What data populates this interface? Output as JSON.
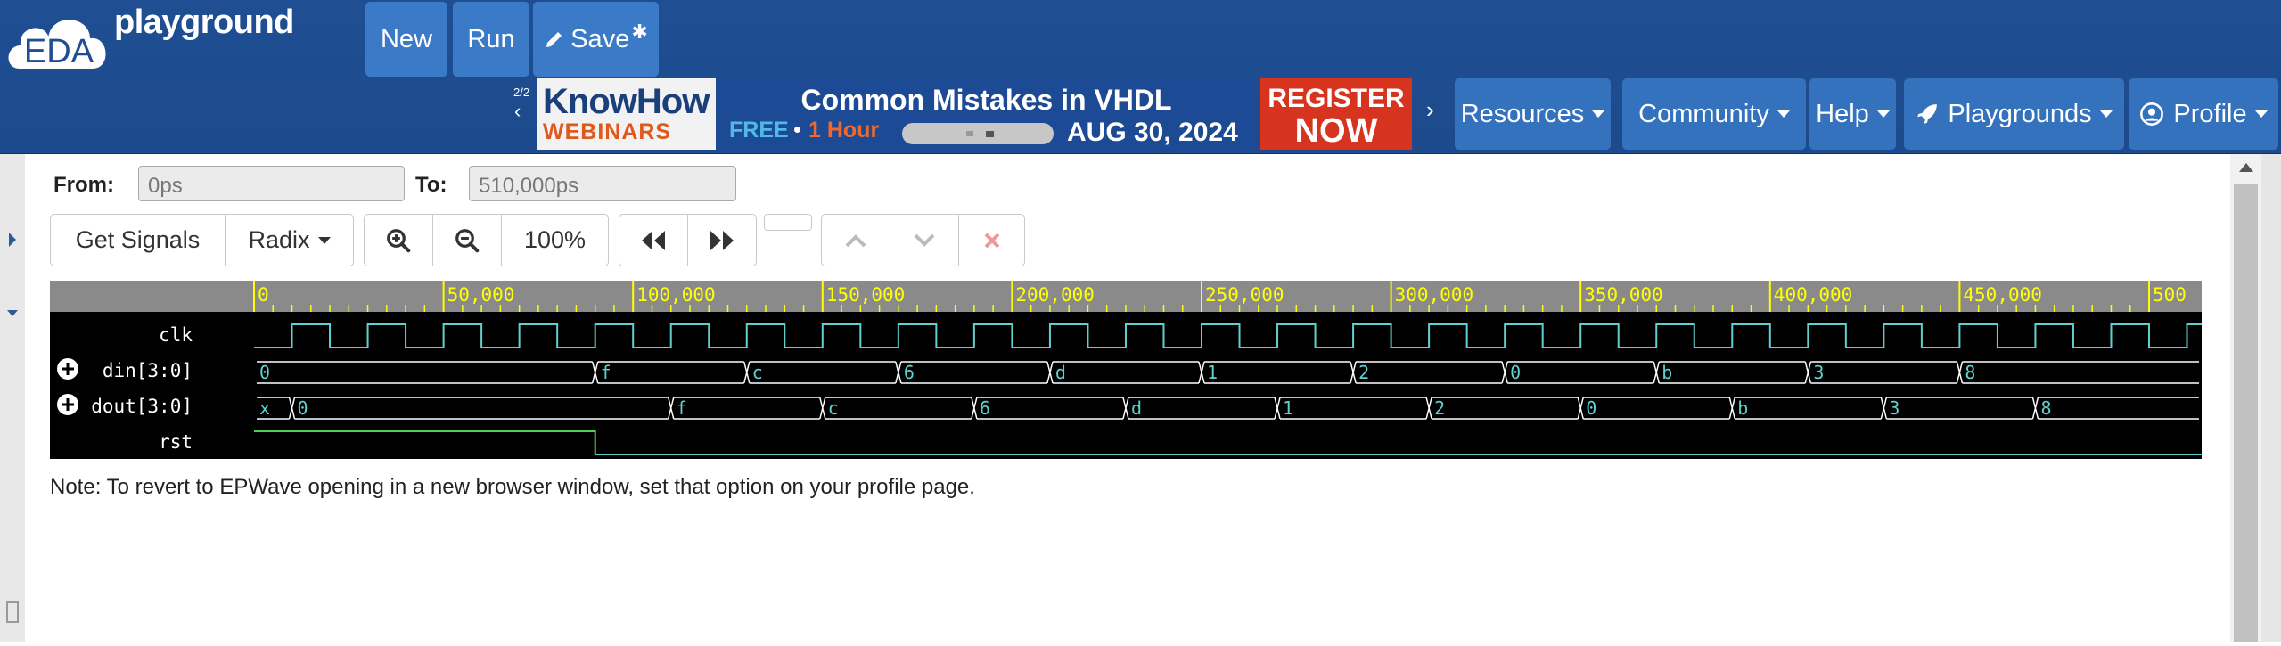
{
  "brand": {
    "logo_text": "EDA",
    "title": "playground"
  },
  "nav": {
    "new_label": "New",
    "run_label": "Run",
    "save_label": "Save",
    "save_star": "✱",
    "resources_label": "Resources",
    "community_label": "Community",
    "help_label": "Help",
    "playgrounds_label": "Playgrounds",
    "profile_label": "Profile"
  },
  "banner": {
    "page_indicator": "2/2",
    "prev_arrow": "‹",
    "next_arrow": "›",
    "knowhow": "KnowHow",
    "webinars": "WEBINARS",
    "headline": "Common Mistakes in VHDL",
    "free": "FREE",
    "dot": "•",
    "hour": "1 Hour",
    "date": "AUG 30, 2024",
    "register_line1": "REGISTER",
    "register_line2": "NOW"
  },
  "range": {
    "from_label": "From:",
    "from_value": "0ps",
    "to_label": "To:",
    "to_value": "510,000ps"
  },
  "toolbar": {
    "get_signals_label": "Get Signals",
    "radix_label": "Radix",
    "zoom_level": "100%"
  },
  "timeline": {
    "ticks": [
      "0",
      "50,000",
      "100,000",
      "150,000",
      "200,000",
      "250,000",
      "300,000",
      "350,000",
      "400,000",
      "450,000",
      "500"
    ]
  },
  "signals": [
    {
      "name": "clk",
      "expandable": false
    },
    {
      "name": "din[3:0]",
      "expandable": true,
      "values": [
        "0",
        "f",
        "c",
        "6",
        "d",
        "1",
        "2",
        "0",
        "b",
        "3",
        "8"
      ]
    },
    {
      "name": "dout[3:0]",
      "expandable": true,
      "values": [
        "x",
        "0",
        "f",
        "c",
        "6",
        "d",
        "1",
        "2",
        "0",
        "b",
        "3",
        "8"
      ]
    },
    {
      "name": "rst",
      "expandable": false
    }
  ],
  "colors": {
    "navbar": "#1f4e93",
    "nav_button": "#3a7ac6",
    "ruler": "#8a8a8a",
    "ruler_text": "#ffff00",
    "wave_clk": "#5fd0d0",
    "wave_bus": "#ffffff",
    "wave_value_text": "#5fd0d0",
    "wave_rst": "#4fd04f"
  },
  "note": "Note: To revert to EPWave opening in a new browser window, set that option on your profile page."
}
